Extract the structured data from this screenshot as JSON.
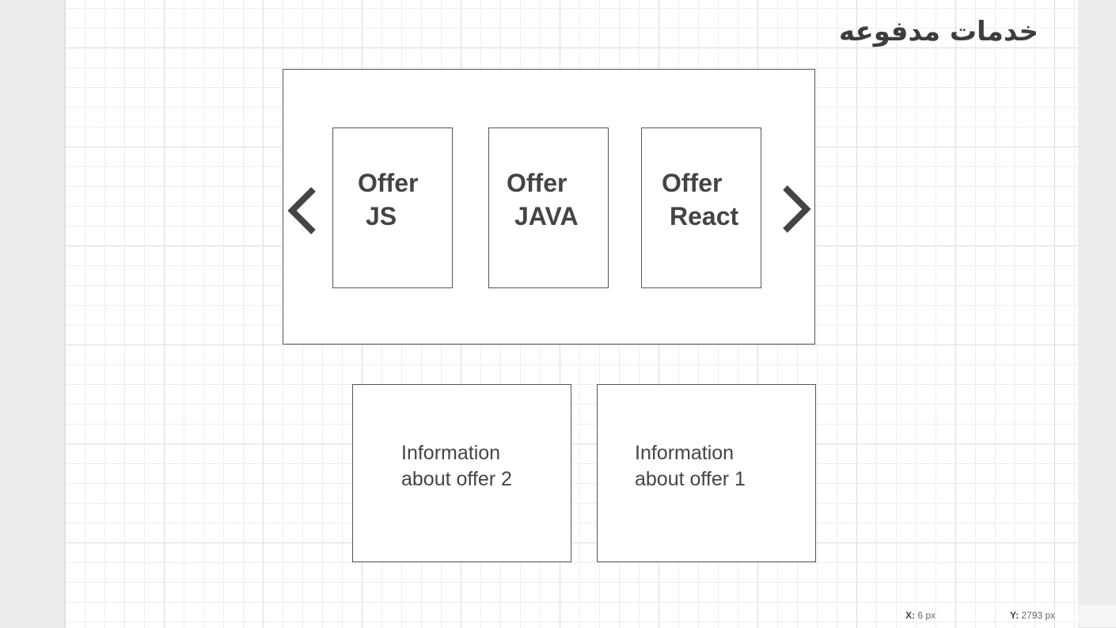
{
  "page": {
    "title": "خدمات مدفوعه"
  },
  "carousel": {
    "offers": [
      {
        "line1": "Offer",
        "line2": "JS"
      },
      {
        "line1": "Offer",
        "line2": "JAVA"
      },
      {
        "line1": "Offer",
        "line2": "React"
      }
    ],
    "prev_icon": "chevron-left-icon",
    "next_icon": "chevron-right-icon"
  },
  "info_cards": [
    {
      "line1": "Information",
      "line2": "about offer 2"
    },
    {
      "line1": "Information",
      "line2": "about offer 1"
    }
  ],
  "status_bar": {
    "x_label": "X:",
    "x_value": "6 px",
    "y_label": "Y:",
    "y_value": "2793 px"
  },
  "colors": {
    "canvas": "#ffffff",
    "grid_major": "#dcdcdc",
    "grid_minor": "#eeeeee",
    "stroke": "#555555",
    "text": "#444444",
    "workspace": "#ececec"
  }
}
